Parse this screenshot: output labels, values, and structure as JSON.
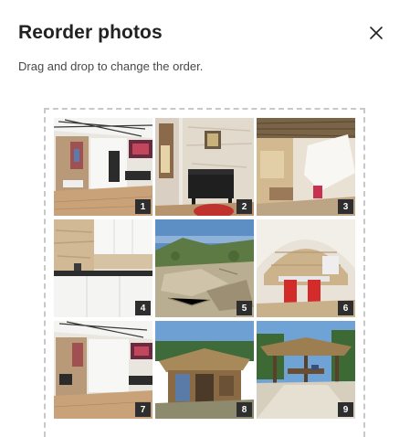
{
  "dialog": {
    "title": "Reorder photos",
    "subtitle": "Drag and drop to change the order.",
    "close_icon": "close-icon"
  },
  "photos": [
    {
      "number": "1",
      "subject": "living room with skylight"
    },
    {
      "number": "2",
      "subject": "stone wall with piano"
    },
    {
      "number": "3",
      "subject": "vaulted bedroom"
    },
    {
      "number": "4",
      "subject": "white kitchen"
    },
    {
      "number": "5",
      "subject": "rocky coastline"
    },
    {
      "number": "6",
      "subject": "dining area with red chairs"
    },
    {
      "number": "7",
      "subject": "living room with skylight"
    },
    {
      "number": "8",
      "subject": "thatched hut"
    },
    {
      "number": "9",
      "subject": "thatched gazebo"
    }
  ],
  "colors": {
    "dashed_border": "#c8c8c8",
    "badge_bg": "#2e2e2e",
    "badge_text": "#ffffff"
  }
}
